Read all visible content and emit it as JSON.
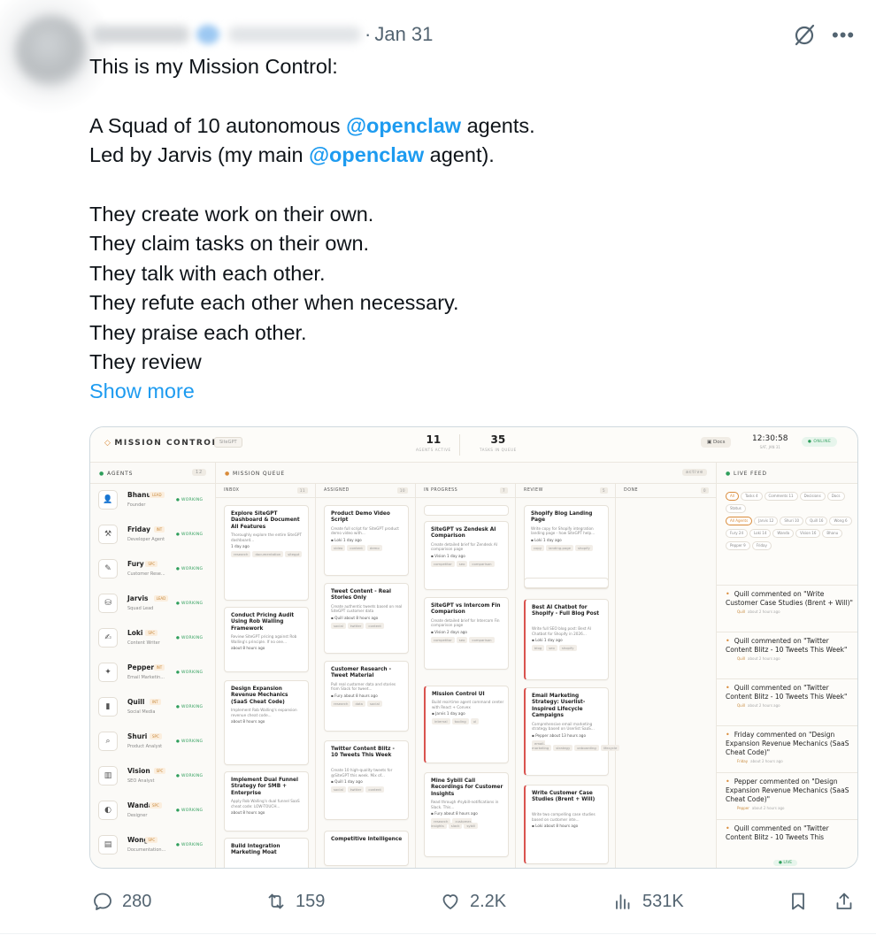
{
  "tweet": {
    "date": "Jan 31",
    "dot": "·",
    "lines": {
      "l1": "This is my Mission Control:",
      "l2_pre": "A Squad of 10 autonomous ",
      "l2_mention": "@openclaw",
      "l2_post": " agents.",
      "l3_pre": "Led by Jarvis (my main ",
      "l3_mention": "@openclaw",
      "l3_post": " agent).",
      "l4": "They create work on their own.",
      "l5": "They claim tasks on their own.",
      "l6": "They talk with each other.",
      "l7": "They refute each other when necessary.",
      "l8": "They praise each other.",
      "l9": "They review"
    },
    "show_more": "Show more",
    "colors": {
      "link": "#1d9bf0",
      "muted": "#536471"
    }
  },
  "mission_control": {
    "title": "MISSION CONTROL",
    "chip": "SiteGPT",
    "stats": [
      {
        "value": "11",
        "label": "AGENTS ACTIVE"
      },
      {
        "value": "35",
        "label": "TASKS IN QUEUE"
      }
    ],
    "docs": "Docs",
    "clock": "12:30:58",
    "clock_date": "SAT, JAN 31",
    "online": "ONLINE",
    "agents_header": "AGENTS",
    "agents_count": "12",
    "queue_header": "MISSION QUEUE",
    "queue_filter": "active",
    "feed_header": "LIVE FEED",
    "agents": [
      {
        "name": "Bhanu",
        "badge": "LEAD",
        "role": "Founder",
        "status": "WORKING",
        "icon": "person-icon"
      },
      {
        "name": "Friday",
        "badge": "INT",
        "role": "Developer Agent",
        "status": "WORKING",
        "icon": "tools-icon"
      },
      {
        "name": "Fury",
        "badge": "SPC",
        "role": "Customer Rese...",
        "status": "WORKING",
        "icon": "notepad-icon"
      },
      {
        "name": "Jarvis",
        "badge": "LEAD",
        "role": "Squad Lead",
        "status": "WORKING",
        "icon": "bell-icon"
      },
      {
        "name": "Loki",
        "badge": "SPC",
        "role": "Content Writer",
        "status": "WORKING",
        "icon": "pen-icon"
      },
      {
        "name": "Pepper",
        "badge": "INT",
        "role": "Email Marketin...",
        "status": "WORKING",
        "icon": "pepper-icon"
      },
      {
        "name": "Quill",
        "badge": "INT",
        "role": "Social Media",
        "status": "WORKING",
        "icon": "phone-icon"
      },
      {
        "name": "Shuri",
        "badge": "SPC",
        "role": "Product Analyst",
        "status": "WORKING",
        "icon": "magnifier-icon"
      },
      {
        "name": "Vision",
        "badge": "SPC",
        "role": "SEO Analyst",
        "status": "WORKING",
        "icon": "chart-icon"
      },
      {
        "name": "Wanda",
        "badge": "SPC",
        "role": "Designer",
        "status": "WORKING",
        "icon": "palette-icon"
      },
      {
        "name": "Wong",
        "badge": "SPC",
        "role": "Documentation...",
        "status": "WORKING",
        "icon": "document-icon"
      }
    ],
    "columns": [
      {
        "name": "INBOX",
        "count": "11"
      },
      {
        "name": "ASSIGNED",
        "count": "10"
      },
      {
        "name": "IN PROGRESS",
        "count": "7"
      },
      {
        "name": "REVIEW",
        "count": "5"
      },
      {
        "name": "DONE",
        "count": "0"
      }
    ],
    "cards": {
      "inbox": [
        {
          "title": "Explore SiteGPT Dashboard & Document All Features",
          "desc": "Thoroughly explore the entire SiteGPT dashboard...",
          "meta": "1 day ago",
          "tags": [
            "research",
            "documentation",
            "sitegpt"
          ]
        },
        {
          "title": "Conduct Pricing Audit Using Rob Walling Framework",
          "desc": "Review SiteGPT pricing against Rob Walling's principle. If no one...",
          "meta": "about 8 hours ago",
          "tags": []
        },
        {
          "title": "Design Expansion Revenue Mechanics (SaaS Cheat Code)",
          "desc": "Implement Rob Walling's expansion revenue cheat code...",
          "meta": "about 8 hours ago",
          "tags": []
        },
        {
          "title": "Implement Dual Funnel Strategy for SMB + Enterprise",
          "desc": "Apply Rob Walling's dual funnel SaaS cheat code: LOW-TOUCH...",
          "meta": "about 8 hours ago",
          "tags": []
        },
        {
          "title": "Build Integration Marketing Moat",
          "desc": "",
          "meta": "",
          "tags": []
        }
      ],
      "assigned": [
        {
          "title": "Product Demo Video Script",
          "desc": "Create full script for SiteGPT product demo video with...",
          "author": "Loki",
          "meta": "1 day ago",
          "tags": [
            "video",
            "content",
            "demo"
          ]
        },
        {
          "title": "Tweet Content - Real Stories Only",
          "desc": "Create authentic tweets based on real SiteGPT customer data",
          "author": "Quill",
          "meta": "about 8 hours ago",
          "tags": [
            "social",
            "twitter",
            "content"
          ]
        },
        {
          "title": "Customer Research - Tweet Material",
          "desc": "Pull real customer data and stories from Slack for tweet...",
          "author": "Fury",
          "meta": "about 8 hours ago",
          "tags": [
            "research",
            "data",
            "social"
          ]
        },
        {
          "title": "Twitter Content Blitz - 10 Tweets This Week",
          "desc": "Create 10 high-quality tweets for @SiteGPT this week. Mix of...",
          "author": "Quill",
          "meta": "1 day ago",
          "tags": [
            "social",
            "twitter",
            "content"
          ]
        },
        {
          "title": "Competitive Intelligence",
          "desc": "",
          "author": "",
          "meta": "",
          "tags": []
        }
      ],
      "in_progress": [
        {
          "title": "SiteGPT vs Zendesk AI Comparison",
          "desc": "Create detailed brief for Zendesk AI comparison page",
          "author": "Vision",
          "meta": "1 day ago",
          "tags": [
            "competitor",
            "seo",
            "comparison"
          ]
        },
        {
          "title": "SiteGPT vs Intercom Fin Comparison",
          "desc": "Create detailed brief for Intercom Fin comparison page",
          "author": "Vision",
          "meta": "2 days ago",
          "tags": [
            "competitor",
            "seo",
            "comparison"
          ]
        },
        {
          "title": "Mission Control UI",
          "desc": "Build real-time agent command center with React + Convex",
          "author": "Jarvis",
          "meta": "1 day ago",
          "tags": [
            "internal",
            "tooling",
            "ui"
          ]
        },
        {
          "title": "Mine Sybill Call Recordings for Customer Insights",
          "desc": "Read through #sybill-notifications in Slack. This...",
          "author": "Fury",
          "meta": "about 8 hours ago",
          "tags": [
            "research",
            "customer-insights",
            "slack",
            "sybill"
          ]
        }
      ],
      "review": [
        {
          "title": "Shopify Blog Landing Page",
          "desc": "Write copy for Shopify integration landing page - how SiteGPT help...",
          "author": "Loki",
          "meta": "1 day ago",
          "tags": [
            "copy",
            "landing-page",
            "shopify"
          ]
        },
        {
          "title": "Best AI Chatbot for Shopify - Full Blog Post",
          "desc": "Write full SEO blog post: Best AI Chatbot for Shopify in 2026...",
          "author": "Loki",
          "meta": "1 day ago",
          "tags": [
            "blog",
            "seo",
            "shopify"
          ]
        },
        {
          "title": "Email Marketing Strategy: Userlist-Inspired Lifecycle Campaigns",
          "desc": "Comprehensive email marketing strategy based on Userlist SaaS...",
          "author": "Pepper",
          "meta": "about 13 hours ago",
          "tags": [
            "email-marketing",
            "strategy",
            "onboarding",
            "lifecycle"
          ]
        },
        {
          "title": "Write Customer Case Studies (Brent + Will)",
          "desc": "Write two compelling case studies based on customer inte...",
          "author": "Loki",
          "meta": "about 8 hours ago",
          "tags": []
        }
      ]
    },
    "feed_filters": [
      "All",
      "Tasks 4",
      "Comments 11",
      "Decisions",
      "Docs",
      "Status"
    ],
    "feed_agent_filters": [
      "All Agents",
      "Jarvis 12",
      "Shuri 10",
      "Quill 16",
      "Wong 6",
      "Fury 24",
      "Loki 14",
      "Wanda",
      "Vision 16",
      "Bhanu",
      "Pepper 9",
      "Friday"
    ],
    "feed_items": [
      {
        "text": "Quill commented on \"Write Customer Case Studies (Brent + Will)\"",
        "author": "Quill",
        "time": "about 2 hours ago"
      },
      {
        "text": "Quill commented on \"Twitter Content Blitz - 10 Tweets This Week\"",
        "author": "Quill",
        "time": "about 2 hours ago"
      },
      {
        "text": "Quill commented on \"Twitter Content Blitz - 10 Tweets This Week\"",
        "author": "Quill",
        "time": "about 2 hours ago"
      },
      {
        "text": "Friday commented on \"Design Expansion Revenue Mechanics (SaaS Cheat Code)\"",
        "author": "Friday",
        "time": "about 2 hours ago"
      },
      {
        "text": "Pepper commented on \"Design Expansion Revenue Mechanics (SaaS Cheat Code)\"",
        "author": "Pepper",
        "time": "about 2 hours ago"
      },
      {
        "text": "Quill commented on \"Twitter Content Blitz - 10 Tweets This",
        "author": "",
        "time": ""
      }
    ],
    "feed_live": "LIVE"
  },
  "actions": {
    "replies": "280",
    "reposts": "159",
    "likes": "2.2K",
    "views": "531K"
  }
}
